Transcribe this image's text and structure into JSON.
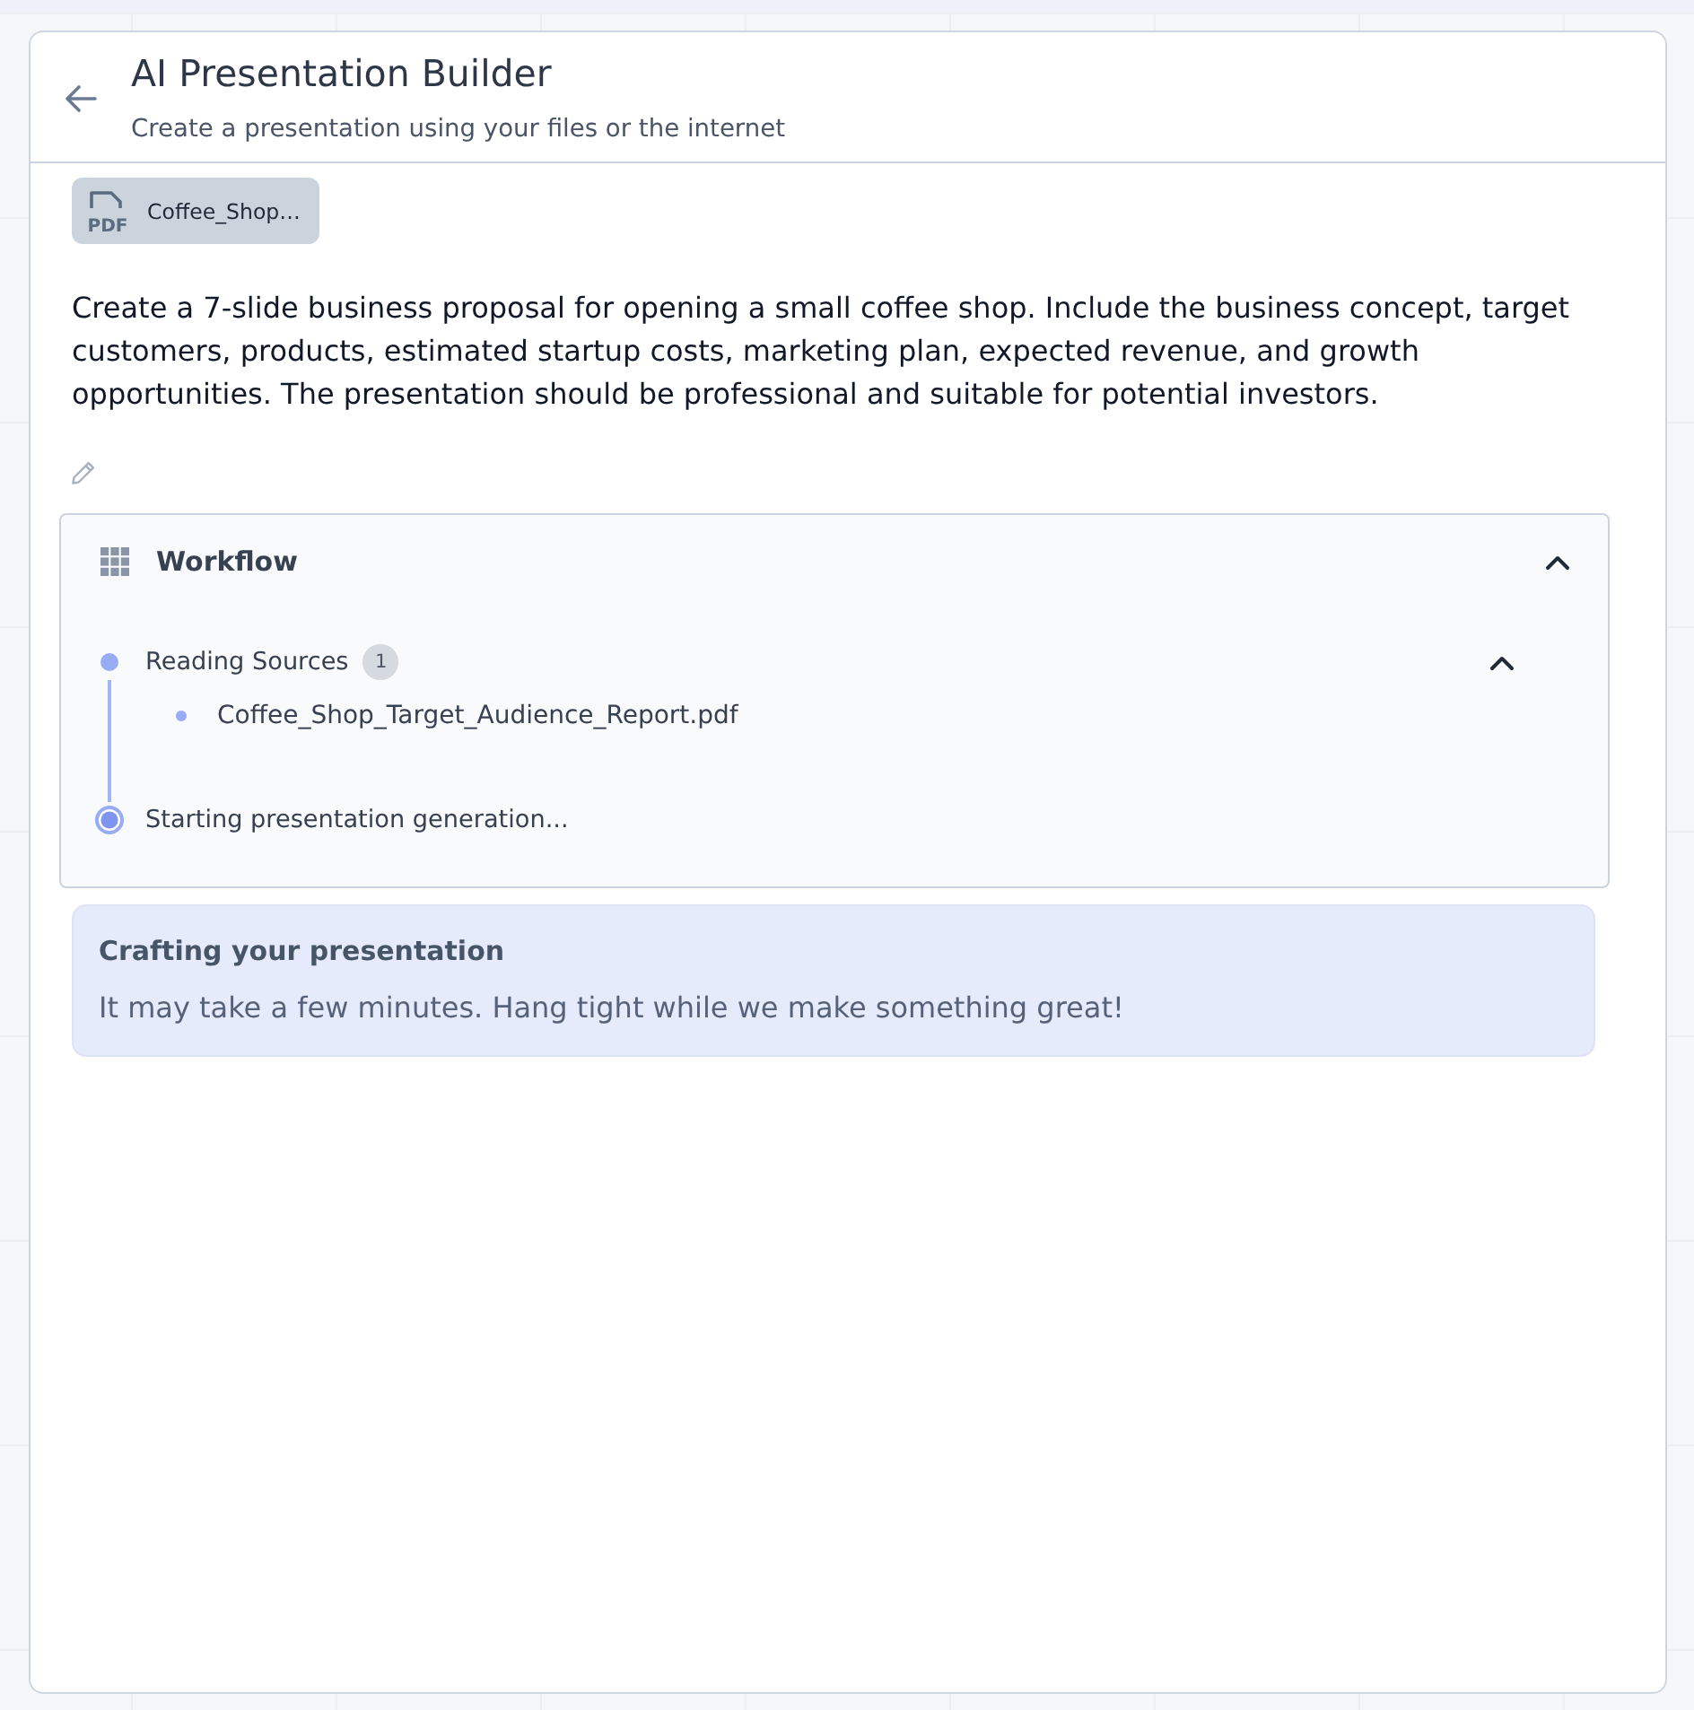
{
  "header": {
    "title": "AI Presentation Builder",
    "subtitle": "Create a presentation using your files or the internet"
  },
  "attachments": [
    {
      "file_type": "PDF",
      "name": "Coffee_Shop…"
    }
  ],
  "prompt": "Create a 7-slide business proposal for opening a small coffee shop. Include the business concept, target customers, products, estimated startup costs, marketing plan, expected revenue, and growth opportunities. The presentation should be professional and suitable for potential investors.",
  "workflow": {
    "title": "Workflow",
    "expanded": true,
    "steps": [
      {
        "label": "Reading Sources",
        "count": "1",
        "active": false,
        "expanded": true,
        "children": [
          {
            "label": "Coffee_Shop_Target_Audience_Report.pdf"
          }
        ]
      },
      {
        "label": "Starting presentation generation...",
        "active": true
      }
    ]
  },
  "notice": {
    "title": "Crafting your presentation",
    "message": "It may take a few minutes. Hang tight while we make something great!"
  }
}
